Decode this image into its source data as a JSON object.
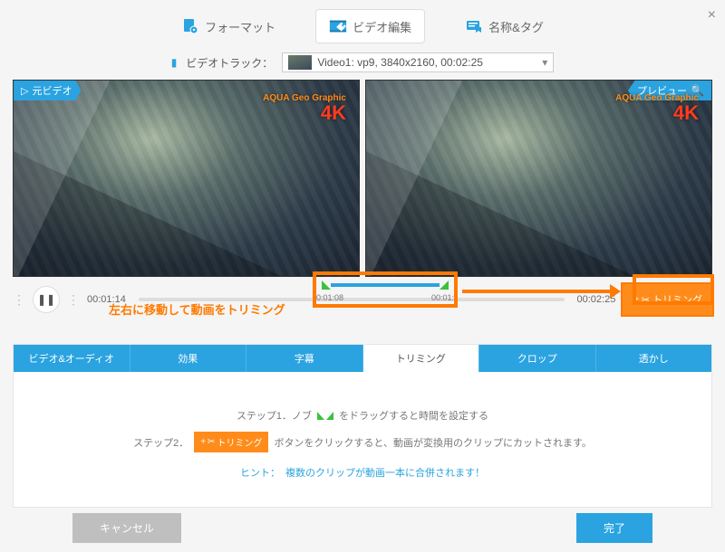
{
  "close_label": "×",
  "top_tabs": {
    "format": "フォーマット",
    "edit": "ビデオ編集",
    "tags": "名称&タグ"
  },
  "track": {
    "label": "ビデオトラック：",
    "selected": "Video1: vp9, 3840x2160, 00:02:25"
  },
  "preview": {
    "left_badge": "元ビデオ",
    "right_badge": "プレビュー",
    "watermark_line1": "AQUA Geo Graphic",
    "watermark_line2": "4K"
  },
  "controls": {
    "pause_glyph": "❚❚",
    "current_time": "00:01:14",
    "total_time": "00:02:25",
    "trim_button": "トリミング",
    "plus": "+"
  },
  "annotation": {
    "text": "左右に移動して動画をトリミング",
    "range_start": "0:01:08",
    "range_end": "00:01:"
  },
  "subtabs": {
    "av": "ビデオ&オーディオ",
    "effect": "効果",
    "subtitle": "字幕",
    "trim": "トリミング",
    "crop": "クロップ",
    "watermark": "透かし"
  },
  "steps": {
    "s1_pre": "ステップ1．ノブ",
    "s1_post": "をドラッグすると時間を設定する",
    "s2_pre": "ステップ2．",
    "s2_btn": "トリミング",
    "s2_post": "ボタンをクリックすると、動画が変換用のクリップにカットされます。",
    "hint_pre": "ヒント：",
    "hint_body": "複数のクリップが動画一本に合併されます！"
  },
  "footer": {
    "cancel": "キャンセル",
    "done": "完了"
  }
}
